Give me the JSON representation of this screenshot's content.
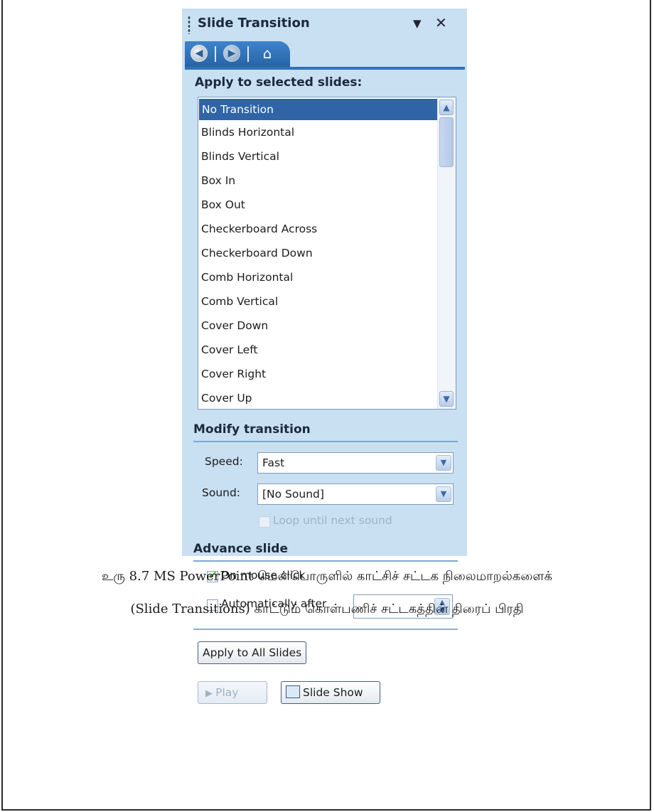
{
  "pane": {
    "title": "Slide Transition",
    "menu_glyph": "▼",
    "close_glyph": "✕",
    "nav": {
      "back_icon": "back-arrow-icon",
      "forward_icon": "forward-arrow-icon",
      "home_icon": "home-icon",
      "accent": "#2f72b8"
    }
  },
  "apply_section": {
    "label": "Apply to selected slides:",
    "items": [
      "No Transition",
      "Blinds Horizontal",
      "Blinds Vertical",
      "Box In",
      "Box Out",
      "Checkerboard Across",
      "Checkerboard Down",
      "Comb Horizontal",
      "Comb Vertical",
      "Cover Down",
      "Cover Left",
      "Cover Right",
      "Cover Up"
    ],
    "selected": "No Transition"
  },
  "modify_section": {
    "label": "Modify transition",
    "speed_label": "Speed:",
    "speed_value": "Fast",
    "sound_label": "Sound:",
    "sound_value": "[No Sound]",
    "loop_label": "Loop until next sound",
    "loop_checked": false
  },
  "advance_section": {
    "label": "Advance slide",
    "on_click_label": "On mouse click",
    "on_click_checked": true,
    "auto_label": "Automatically after",
    "auto_checked": false,
    "auto_value": ""
  },
  "buttons": {
    "apply_all": "Apply to All Slides",
    "play": "Play",
    "slide_show": "Slide Show"
  },
  "caption": {
    "line1": "உரு 8.7 MS PowerPoint மென்பொருளில் காட்சிச் சட்டக நிலைமாறல்களைக்",
    "line2": "(Slide Transitions) காட்டும் கொள்பணிச் சட்டகத்தின் திரைப் பிரதி"
  }
}
